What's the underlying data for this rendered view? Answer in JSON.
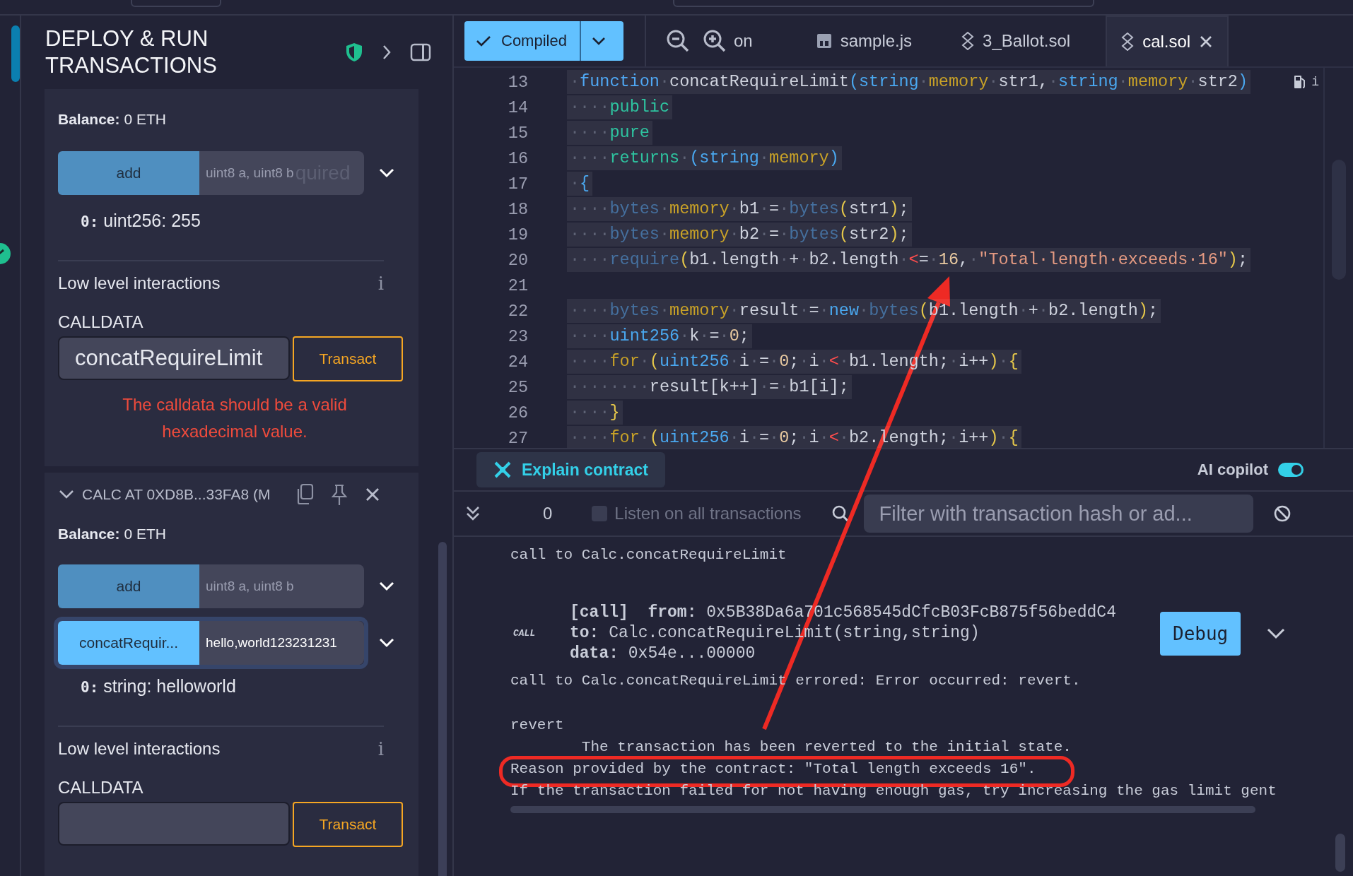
{
  "panel": {
    "title": "DEPLOY & RUN TRANSACTIONS"
  },
  "instances": [
    {
      "balance_label": "Balance:",
      "balance": "0 ETH",
      "functions": [
        {
          "label": "add",
          "placeholder": "uint8 a, uint8 b",
          "ghost": "quired",
          "focused": false,
          "result": {
            "index": "0:",
            "text": "uint256: 255"
          }
        }
      ],
      "low_level": {
        "title": "Low level interactions",
        "info": "i",
        "calldata_label": "CALLDATA",
        "calldata_value": "concatRequireLimit",
        "button": "Transact",
        "error": "The calldata should be a valid hexadecimal value."
      }
    },
    {
      "header": {
        "title": "CALC AT 0XD8B...33FA8 (M"
      },
      "balance_label": "Balance:",
      "balance": "0 ETH",
      "functions": [
        {
          "label": "add",
          "placeholder": "uint8 a, uint8 b",
          "focused": false
        },
        {
          "label": "concatRequir...",
          "value": "hello,world123231231",
          "focused": true,
          "result": {
            "index": "0:",
            "text": "string: helloworld"
          }
        }
      ],
      "low_level": {
        "title": "Low level interactions",
        "info": "i",
        "calldata_label": "CALLDATA",
        "button": "Transact"
      }
    }
  ],
  "editor": {
    "compile_button": "Compiled",
    "zoom_label": "on",
    "tabs": [
      {
        "label": "sample.js",
        "kind": "js",
        "selected": false
      },
      {
        "label": "3_Ballot.sol",
        "kind": "sol",
        "selected": false
      },
      {
        "label": "cal.sol",
        "kind": "sol",
        "selected": true
      }
    ],
    "line_hint": "i",
    "lines": [
      {
        "number": "13",
        "highlighted": true,
        "tokens": [
          {
            "kind": "ws",
            "text": "·"
          },
          {
            "kind": "kw",
            "text": "function"
          },
          {
            "kind": "ws",
            "text": "·"
          },
          {
            "kind": "id",
            "text": "concatRequireLimit"
          },
          {
            "kind": "type",
            "text": "(string"
          },
          {
            "kind": "ws",
            "text": "·"
          },
          {
            "kind": "loc",
            "text": "memory"
          },
          {
            "kind": "ws",
            "text": "·"
          },
          {
            "kind": "id",
            "text": "str1,"
          },
          {
            "kind": "ws",
            "text": "·"
          },
          {
            "kind": "type",
            "text": "string"
          },
          {
            "kind": "ws",
            "text": "·"
          },
          {
            "kind": "loc",
            "text": "memory"
          },
          {
            "kind": "ws",
            "text": "·"
          },
          {
            "kind": "id",
            "text": "str2"
          },
          {
            "kind": "type",
            "text": ")"
          }
        ]
      },
      {
        "number": "14",
        "highlighted": true,
        "tokens": [
          {
            "kind": "ws",
            "text": "····"
          },
          {
            "kind": "mod",
            "text": "public"
          }
        ]
      },
      {
        "number": "15",
        "highlighted": true,
        "tokens": [
          {
            "kind": "ws",
            "text": "····"
          },
          {
            "kind": "mod",
            "text": "pure"
          }
        ]
      },
      {
        "number": "16",
        "highlighted": true,
        "tokens": [
          {
            "kind": "ws",
            "text": "····"
          },
          {
            "kind": "mod",
            "text": "returns"
          },
          {
            "kind": "ws",
            "text": "·"
          },
          {
            "kind": "type",
            "text": "(string"
          },
          {
            "kind": "ws",
            "text": "·"
          },
          {
            "kind": "loc",
            "text": "memory"
          },
          {
            "kind": "type",
            "text": ")"
          }
        ]
      },
      {
        "number": "17",
        "highlighted": true,
        "tokens": [
          {
            "kind": "ws",
            "text": "·"
          },
          {
            "kind": "type",
            "text": "{"
          }
        ]
      },
      {
        "number": "18",
        "highlighted": true,
        "tokens": [
          {
            "kind": "ws",
            "text": "····"
          },
          {
            "kind": "bi",
            "text": "bytes"
          },
          {
            "kind": "ws",
            "text": "·"
          },
          {
            "kind": "loc",
            "text": "memory"
          },
          {
            "kind": "ws",
            "text": "·"
          },
          {
            "kind": "id",
            "text": "b1"
          },
          {
            "kind": "ws",
            "text": "·"
          },
          {
            "kind": "id",
            "text": "="
          },
          {
            "kind": "ws",
            "text": "·"
          },
          {
            "kind": "bi",
            "text": "bytes"
          },
          {
            "kind": "brace",
            "text": "("
          },
          {
            "kind": "id",
            "text": "str1"
          },
          {
            "kind": "brace",
            "text": ")"
          },
          {
            "kind": "id",
            "text": ";"
          }
        ]
      },
      {
        "number": "19",
        "highlighted": true,
        "tokens": [
          {
            "kind": "ws",
            "text": "····"
          },
          {
            "kind": "bi",
            "text": "bytes"
          },
          {
            "kind": "ws",
            "text": "·"
          },
          {
            "kind": "loc",
            "text": "memory"
          },
          {
            "kind": "ws",
            "text": "·"
          },
          {
            "kind": "id",
            "text": "b2"
          },
          {
            "kind": "ws",
            "text": "·"
          },
          {
            "kind": "id",
            "text": "="
          },
          {
            "kind": "ws",
            "text": "·"
          },
          {
            "kind": "bi",
            "text": "bytes"
          },
          {
            "kind": "brace",
            "text": "("
          },
          {
            "kind": "id",
            "text": "str2"
          },
          {
            "kind": "brace",
            "text": ")"
          },
          {
            "kind": "id",
            "text": ";"
          }
        ]
      },
      {
        "number": "20",
        "highlighted": true,
        "tokens": [
          {
            "kind": "ws",
            "text": "····"
          },
          {
            "kind": "bi",
            "text": "require"
          },
          {
            "kind": "brace",
            "text": "("
          },
          {
            "kind": "id",
            "text": "b1.length"
          },
          {
            "kind": "ws",
            "text": "·"
          },
          {
            "kind": "id",
            "text": "+"
          },
          {
            "kind": "ws",
            "text": "·"
          },
          {
            "kind": "id",
            "text": "b2.length"
          },
          {
            "kind": "ws",
            "text": "·"
          },
          {
            "kind": "red",
            "text": "<"
          },
          {
            "kind": "id",
            "text": "="
          },
          {
            "kind": "ws",
            "text": "·"
          },
          {
            "kind": "num",
            "text": "16"
          },
          {
            "kind": "id",
            "text": ","
          },
          {
            "kind": "ws",
            "text": "·"
          },
          {
            "kind": "str",
            "text": "\"Total·length·exceeds·16\""
          },
          {
            "kind": "brace",
            "text": ")"
          },
          {
            "kind": "id",
            "text": ";"
          }
        ]
      },
      {
        "number": "21"
      },
      {
        "number": "22",
        "highlighted": true,
        "tokens": [
          {
            "kind": "ws",
            "text": "····"
          },
          {
            "kind": "bi",
            "text": "bytes"
          },
          {
            "kind": "ws",
            "text": "·"
          },
          {
            "kind": "loc",
            "text": "memory"
          },
          {
            "kind": "ws",
            "text": "·"
          },
          {
            "kind": "id",
            "text": "result"
          },
          {
            "kind": "ws",
            "text": "·"
          },
          {
            "kind": "id",
            "text": "="
          },
          {
            "kind": "ws",
            "text": "·"
          },
          {
            "kind": "type",
            "text": "new"
          },
          {
            "kind": "ws",
            "text": "·"
          },
          {
            "kind": "bi",
            "text": "bytes"
          },
          {
            "kind": "brace",
            "text": "("
          },
          {
            "kind": "id",
            "text": "b1.length"
          },
          {
            "kind": "ws",
            "text": "·"
          },
          {
            "kind": "id",
            "text": "+"
          },
          {
            "kind": "ws",
            "text": "·"
          },
          {
            "kind": "id",
            "text": "b2.length"
          },
          {
            "kind": "brace",
            "text": ")"
          },
          {
            "kind": "id",
            "text": ";"
          }
        ]
      },
      {
        "number": "23",
        "highlighted": true,
        "tokens": [
          {
            "kind": "ws",
            "text": "····"
          },
          {
            "kind": "type",
            "text": "uint256"
          },
          {
            "kind": "ws",
            "text": "·"
          },
          {
            "kind": "id",
            "text": "k"
          },
          {
            "kind": "ws",
            "text": "·"
          },
          {
            "kind": "id",
            "text": "="
          },
          {
            "kind": "ws",
            "text": "·"
          },
          {
            "kind": "num",
            "text": "0"
          },
          {
            "kind": "id",
            "text": ";"
          }
        ]
      },
      {
        "number": "24",
        "highlighted": true,
        "tokens": [
          {
            "kind": "ws",
            "text": "····"
          },
          {
            "kind": "loc",
            "text": "for"
          },
          {
            "kind": "ws",
            "text": "·"
          },
          {
            "kind": "brace",
            "text": "("
          },
          {
            "kind": "type",
            "text": "uint256"
          },
          {
            "kind": "ws",
            "text": "·"
          },
          {
            "kind": "id",
            "text": "i"
          },
          {
            "kind": "ws",
            "text": "·"
          },
          {
            "kind": "id",
            "text": "="
          },
          {
            "kind": "ws",
            "text": "·"
          },
          {
            "kind": "num",
            "text": "0"
          },
          {
            "kind": "id",
            "text": ";"
          },
          {
            "kind": "ws",
            "text": "·"
          },
          {
            "kind": "id",
            "text": "i"
          },
          {
            "kind": "ws",
            "text": "·"
          },
          {
            "kind": "red",
            "text": "<"
          },
          {
            "kind": "ws",
            "text": "·"
          },
          {
            "kind": "id",
            "text": "b1.length;"
          },
          {
            "kind": "ws",
            "text": "·"
          },
          {
            "kind": "id",
            "text": "i++"
          },
          {
            "kind": "brace",
            "text": ")"
          },
          {
            "kind": "ws",
            "text": "·"
          },
          {
            "kind": "brace",
            "text": "{"
          }
        ]
      },
      {
        "number": "25",
        "highlighted": true,
        "tokens": [
          {
            "kind": "ws",
            "text": "········"
          },
          {
            "kind": "id",
            "text": "result[k++]"
          },
          {
            "kind": "ws",
            "text": "·"
          },
          {
            "kind": "id",
            "text": "="
          },
          {
            "kind": "ws",
            "text": "·"
          },
          {
            "kind": "id",
            "text": "b1[i];"
          }
        ]
      },
      {
        "number": "26",
        "highlighted": true,
        "tokens": [
          {
            "kind": "ws",
            "text": "····"
          },
          {
            "kind": "brace",
            "text": "}"
          }
        ]
      },
      {
        "number": "27",
        "highlighted": true,
        "tokens": [
          {
            "kind": "ws",
            "text": "····"
          },
          {
            "kind": "loc",
            "text": "for"
          },
          {
            "kind": "ws",
            "text": "·"
          },
          {
            "kind": "brace",
            "text": "("
          },
          {
            "kind": "type",
            "text": "uint256"
          },
          {
            "kind": "ws",
            "text": "·"
          },
          {
            "kind": "id",
            "text": "i"
          },
          {
            "kind": "ws",
            "text": "·"
          },
          {
            "kind": "id",
            "text": "="
          },
          {
            "kind": "ws",
            "text": "·"
          },
          {
            "kind": "num",
            "text": "0"
          },
          {
            "kind": "id",
            "text": ";"
          },
          {
            "kind": "ws",
            "text": "·"
          },
          {
            "kind": "id",
            "text": "i"
          },
          {
            "kind": "ws",
            "text": "·"
          },
          {
            "kind": "red",
            "text": "<"
          },
          {
            "kind": "ws",
            "text": "·"
          },
          {
            "kind": "id",
            "text": "b2.length;"
          },
          {
            "kind": "ws",
            "text": "·"
          },
          {
            "kind": "id",
            "text": "i++"
          },
          {
            "kind": "brace",
            "text": ")"
          },
          {
            "kind": "ws",
            "text": "·"
          },
          {
            "kind": "brace",
            "text": "{"
          }
        ]
      }
    ]
  },
  "explain_bar": {
    "button": "Explain contract",
    "copilot_label": "AI copilot",
    "copilot_on": true
  },
  "terminal": {
    "count": "0",
    "listen_label": "Listen on all transactions",
    "listen_checked": false,
    "filter_placeholder": "Filter with transaction hash or ad...",
    "entries": [
      {
        "kind": "text",
        "text": "call to Calc.concatRequireLimit"
      },
      {
        "kind": "call",
        "tag": "CALL",
        "fields": [
          "**[call]**  **from:** 0x5B38Da6a701c568545dCfcB03FcB875f56beddC4",
          "**to:** Calc.concatRequireLimit(string,string)",
          "**data:** 0x54e...00000"
        ],
        "button": "Debug"
      },
      {
        "kind": "text",
        "text": "call to Calc.concatRequireLimit errored: Error occurred: revert."
      },
      {
        "kind": "spacer"
      },
      {
        "kind": "text",
        "text": "revert"
      },
      {
        "kind": "text",
        "text": "        The transaction has been reverted to the initial state."
      },
      {
        "kind": "text",
        "text": "Reason provided by the contract: \"Total length exceeds 16\".",
        "circled": true
      },
      {
        "kind": "text",
        "text": "If the transaction failed for not having enough gas, try increasing the gas limit gent"
      }
    ]
  },
  "annotations": [
    {
      "kind": "arrow"
    }
  ]
}
